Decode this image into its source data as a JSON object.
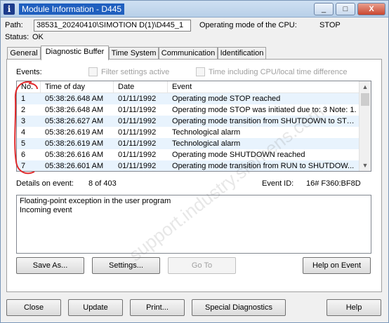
{
  "window": {
    "title": "Module Information - D445",
    "controls": {
      "minimize": "_",
      "maximize": "□",
      "close": "X"
    }
  },
  "header": {
    "path_label": "Path:",
    "path_value": "38531_20240410\\SIMOTION D(1)\\D445_1",
    "mode_label": "Operating mode of the  CPU:",
    "mode_value": "STOP",
    "status_label": "Status:",
    "status_value": "OK"
  },
  "tabs": [
    {
      "label": "General"
    },
    {
      "label": "Diagnostic Buffer"
    },
    {
      "label": "Time System"
    },
    {
      "label": "Communication"
    },
    {
      "label": "Identification"
    }
  ],
  "events": {
    "label": "Events:",
    "filter_label": "Filter settings active",
    "time_label": "Time including CPU/local time difference",
    "columns": [
      "No.",
      "Time of day",
      "Date",
      "Event"
    ],
    "rows": [
      {
        "no": "1",
        "time": "05:38:26.648 AM",
        "date": "01/11/1992",
        "event": "Operating mode STOP reached"
      },
      {
        "no": "2",
        "time": "05:38:26.648 AM",
        "date": "01/11/1992",
        "event": "Operating mode STOP was initiated due to: 3 Note: 1."
      },
      {
        "no": "3",
        "time": "05:38:26.627 AM",
        "date": "01/11/1992",
        "event": "Operating mode transition from SHUTDOWN to STO..."
      },
      {
        "no": "4",
        "time": "05:38:26.619 AM",
        "date": "01/11/1992",
        "event": "Technological alarm"
      },
      {
        "no": "5",
        "time": "05:38:26.619 AM",
        "date": "01/11/1992",
        "event": "Technological alarm"
      },
      {
        "no": "6",
        "time": "05:38:26.616 AM",
        "date": "01/11/1992",
        "event": "Operating mode SHUTDOWN reached"
      },
      {
        "no": "7",
        "time": "05:38:26.601 AM",
        "date": "01/11/1992",
        "event": "Operating mode transition from RUN to SHUTDOW..."
      }
    ]
  },
  "details": {
    "label": "Details on event:",
    "position": "8 of 403",
    "event_id_label": "Event ID:",
    "event_id_value": "16# F360:BF8D",
    "lines": [
      "Floating-point exception in the user program",
      "Incoming event"
    ]
  },
  "panel_buttons": {
    "save_as": "Save As...",
    "settings": "Settings...",
    "go_to": "Go To",
    "help_on_event": "Help on Event"
  },
  "footer_buttons": {
    "close": "Close",
    "update": "Update",
    "print": "Print...",
    "special_diagnostics": "Special Diagnostics",
    "help": "Help"
  },
  "watermark": "support.industry.siemens.com",
  "colors": {
    "selection": "#cce8ff",
    "row_alt": "#e8f3fd",
    "annotation": "#e0282a",
    "title_highlight": "#1f5fbf"
  }
}
